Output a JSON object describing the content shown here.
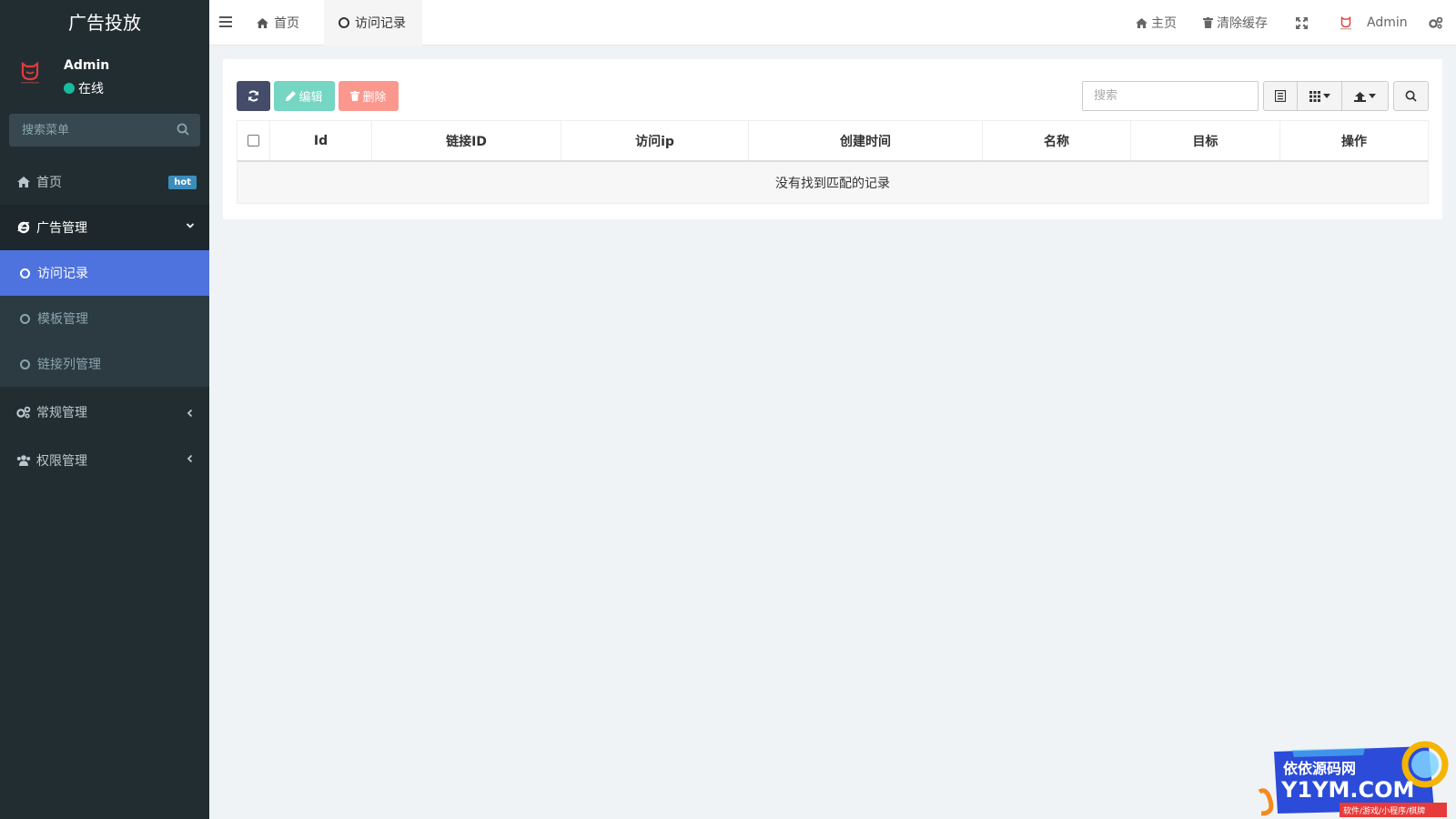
{
  "brand": {
    "title": "广告投放"
  },
  "user": {
    "name": "Admin",
    "status": "在线",
    "status_color": "#18bc9c"
  },
  "menu_search": {
    "placeholder": "搜索菜单"
  },
  "nav": {
    "home": {
      "label": "首页",
      "badge": "hot",
      "icon": "home-icon"
    },
    "ads": {
      "label": "广告管理",
      "icon": "ie-icon",
      "children": [
        {
          "label": "访问记录",
          "active": true
        },
        {
          "label": "模板管理"
        },
        {
          "label": "链接列管理"
        }
      ]
    },
    "general": {
      "label": "常规管理",
      "icon": "cogs-icon"
    },
    "permission": {
      "label": "权限管理",
      "icon": "users-icon"
    }
  },
  "header": {
    "tabs": [
      {
        "label": "首页",
        "icon": "home-icon"
      },
      {
        "label": "访问记录",
        "icon": "circle-icon",
        "active": true
      }
    ],
    "right": {
      "home_label": "主页",
      "clear_cache_label": "清除缓存",
      "user_name": "Admin"
    }
  },
  "toolbar": {
    "edit_label": "编辑",
    "delete_label": "删除",
    "search_placeholder": "搜索"
  },
  "table": {
    "columns": [
      "Id",
      "链接ID",
      "访问ip",
      "创建时间",
      "名称",
      "目标",
      "操作"
    ],
    "empty_text": "没有找到匹配的记录"
  },
  "watermark": {
    "line1": "依依源码网",
    "line2": "Y1YM.COM",
    "line3": "软件/游戏/小程序/棋牌"
  },
  "colors": {
    "sidebar_bg": "#222d32",
    "active_item": "#4e73df",
    "edit_btn": "#18bc9c",
    "delete_btn": "#f75444",
    "refresh_btn": "#444c69",
    "hot_badge": "#3c8dbc"
  }
}
